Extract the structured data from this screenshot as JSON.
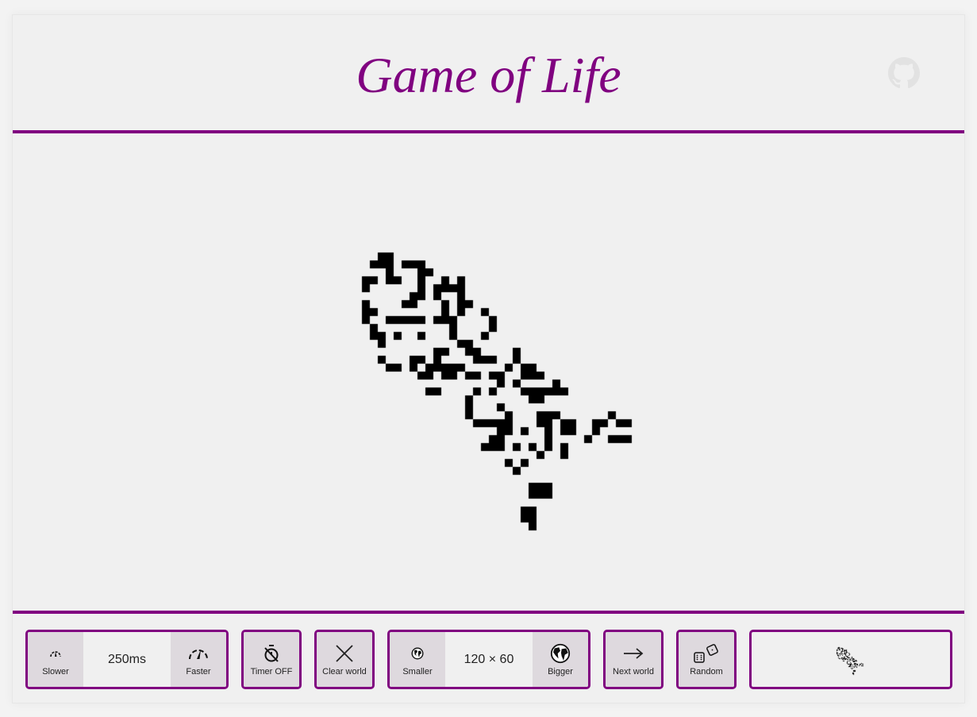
{
  "header": {
    "title": "Game of Life",
    "github_icon": "github-icon"
  },
  "colors": {
    "accent": "#800080",
    "button_bg": "#ded9de",
    "page_bg": "#f0f0f0",
    "cell_alive": "#000000",
    "github_icon": "#e2e2e2"
  },
  "controls": {
    "speed": {
      "slower_label": "Slower",
      "slower_icon": "gauge-low-icon",
      "value": "250ms",
      "faster_label": "Faster",
      "faster_icon": "gauge-high-icon"
    },
    "timer": {
      "label": "Timer OFF",
      "icon": "stopwatch-off-icon"
    },
    "clear": {
      "label": "Clear world",
      "icon": "close-icon"
    },
    "size": {
      "smaller_label": "Smaller",
      "smaller_icon": "globe-small-icon",
      "value": "120 × 60",
      "bigger_label": "Bigger",
      "bigger_icon": "globe-large-icon"
    },
    "next": {
      "label": "Next world",
      "icon": "arrow-right-icon"
    },
    "random": {
      "label": "Random",
      "icon": "dice-icon"
    },
    "preview": {
      "label": ""
    }
  },
  "world": {
    "cols": 120,
    "rows": 60,
    "pattern_origin": {
      "col": 44,
      "row": 15
    },
    "live_cells_by_row": [
      [
        2,
        3
      ],
      [
        1,
        2,
        3,
        5,
        6,
        7
      ],
      [
        3,
        7,
        8
      ],
      [
        0,
        1,
        3,
        4,
        7,
        10,
        12
      ],
      [
        0,
        7,
        9,
        10,
        11,
        12
      ],
      [
        6,
        7,
        9,
        12
      ],
      [
        0,
        5,
        6,
        10,
        12,
        13
      ],
      [
        0,
        1,
        10,
        12,
        15
      ],
      [
        0,
        3,
        4,
        5,
        6,
        7,
        9,
        10,
        11,
        16
      ],
      [
        1,
        11,
        16
      ],
      [
        1,
        2,
        4,
        7,
        11,
        15
      ],
      [
        2,
        12,
        13
      ],
      [
        9,
        10,
        13,
        14,
        19
      ],
      [
        2,
        6,
        7,
        9,
        14,
        15,
        16,
        19
      ],
      [
        3,
        4,
        6,
        8,
        9,
        10,
        11,
        12,
        18,
        20,
        21
      ],
      [
        7,
        8,
        10,
        11,
        13,
        14,
        16,
        17,
        20,
        21,
        22
      ],
      [
        17,
        19,
        24
      ],
      [
        8,
        9,
        14,
        16,
        20,
        21,
        22,
        23,
        24,
        25
      ],
      [
        13,
        21,
        22
      ],
      [
        13,
        17
      ],
      [
        13,
        18,
        22,
        23,
        24,
        31
      ],
      [
        14,
        15,
        16,
        17,
        18,
        22,
        23,
        25,
        26,
        29,
        30,
        32,
        33
      ],
      [
        17,
        18,
        20,
        23,
        25,
        26,
        29
      ],
      [
        16,
        17,
        23,
        28,
        31,
        32,
        33
      ],
      [
        15,
        16,
        17,
        19,
        21,
        23,
        25
      ],
      [
        22,
        25
      ],
      [
        18,
        20
      ],
      [
        19
      ],
      [],
      [
        21,
        22,
        23
      ],
      [
        21,
        22,
        23
      ],
      [],
      [
        20,
        21
      ],
      [
        20,
        21
      ],
      [
        21
      ]
    ]
  }
}
